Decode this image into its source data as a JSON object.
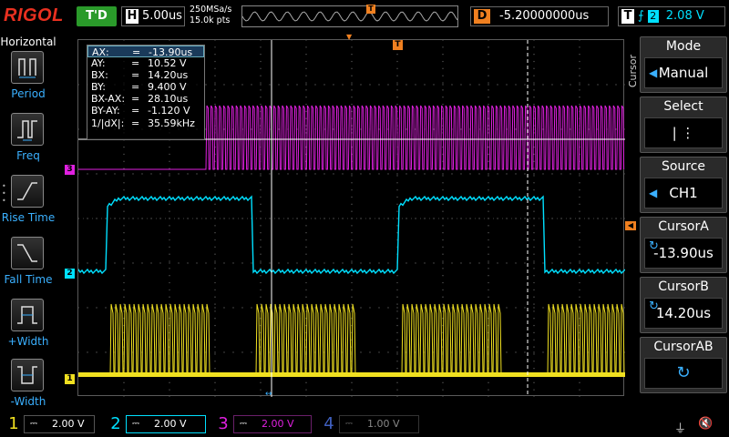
{
  "top": {
    "brand": "RIGOL",
    "run_state": "T'D",
    "timebase_tag": "H",
    "timebase": "5.00us",
    "sample_rate": "250MSa/s",
    "mem_depth": "15.0k pts",
    "delay_tag": "D",
    "delay": "-5.20000000us",
    "trigger_tag": "T",
    "trigger_edge": "rising-edge-icon",
    "trigger_source": "2",
    "trigger_level": "2.08 V"
  },
  "left_panel": {
    "title": "Horizontal",
    "items": [
      {
        "label": "Period",
        "icon": "period-icon"
      },
      {
        "label": "Freq",
        "icon": "freq-icon"
      },
      {
        "label": "Rise Time",
        "icon": "rise-time-icon"
      },
      {
        "label": "Fall Time",
        "icon": "fall-time-icon"
      },
      {
        "label": "+Width",
        "icon": "pos-width-icon"
      },
      {
        "label": "-Width",
        "icon": "neg-width-icon"
      }
    ]
  },
  "cursor_readout": {
    "rows": [
      {
        "key": "AX:",
        "eq": "=",
        "value": "-13.90us"
      },
      {
        "key": "AY:",
        "eq": "=",
        "value": "10.52 V"
      },
      {
        "key": "BX:",
        "eq": "=",
        "value": "14.20us"
      },
      {
        "key": "BY:",
        "eq": "=",
        "value": "9.400 V"
      },
      {
        "key": "BX-AX:",
        "eq": "=",
        "value": "28.10us"
      },
      {
        "key": "BY-AY:",
        "eq": "=",
        "value": "-1.120 V"
      },
      {
        "key": "1/|dX|:",
        "eq": "=",
        "value": "35.59kHz"
      }
    ]
  },
  "plot_markers": {
    "ch3": "3",
    "ch2": "2",
    "ch1": "1",
    "trigger_pos": "T"
  },
  "right_menu": {
    "vertical_label": "Cursor",
    "mode_title": "Mode",
    "mode_value": "Manual",
    "select_title": "Select",
    "select_value": "| ⋮",
    "source_title": "Source",
    "source_value": "CH1",
    "cursor_a_title": "CursorA",
    "cursor_a_value": "-13.90us",
    "cursor_b_title": "CursorB",
    "cursor_b_value": "14.20us",
    "cursor_ab_title": "CursorAB"
  },
  "channels": [
    {
      "num": "1",
      "coupling": "⎓",
      "scale": "2.00 V",
      "color": "#f0e020"
    },
    {
      "num": "2",
      "coupling": "⎓",
      "scale": "2.00 V",
      "color": "#00e0ff"
    },
    {
      "num": "3",
      "coupling": "⎓",
      "scale": "2.00 V",
      "color": "#e020e0"
    },
    {
      "num": "4",
      "coupling": "⎓",
      "scale": "1.00 V",
      "color": "#4060c0"
    }
  ],
  "colors": {
    "ch1": "#f0e020",
    "ch2": "#00e0ff",
    "ch3": "#e020e0",
    "trigger": "#f08020",
    "accent": "#3ab0ff"
  }
}
